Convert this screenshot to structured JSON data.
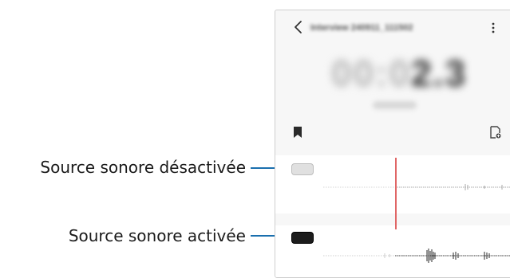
{
  "callouts": {
    "inactive_label": "Source sonore désactivée",
    "active_label": "Source sonore activée"
  },
  "recorder": {
    "title": "Interview 240911_111502",
    "timer_dim": "00:0",
    "timer_main": "2.3"
  },
  "icons": {
    "back": "chevron-left",
    "more": "vertical-ellipsis",
    "bookmark": "bookmark",
    "add_tag": "add-tag"
  },
  "colors": {
    "accent_line": "#1a6fae",
    "playhead": "#e06666",
    "toggle_on": "#1c1c1c",
    "toggle_off": "#e0e0e0"
  },
  "sound_sources": [
    {
      "state": "off"
    },
    {
      "state": "on"
    }
  ]
}
